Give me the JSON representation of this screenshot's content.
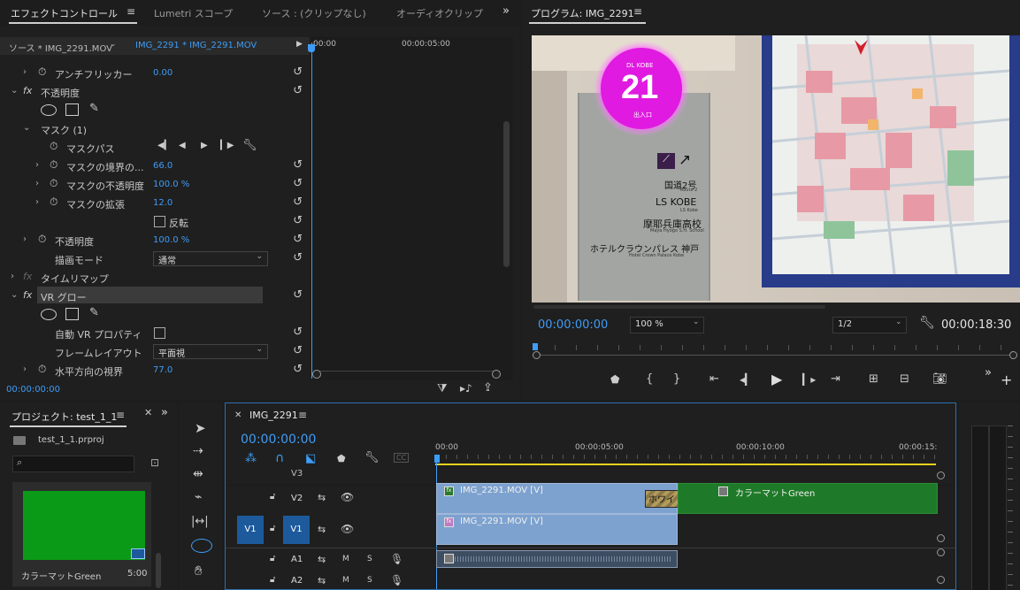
{
  "effects_panel": {
    "tabs": [
      {
        "label": "エフェクトコントロール",
        "active": true
      },
      {
        "label": "Lumetri スコープ"
      },
      {
        "label": "ソース : (クリップなし)"
      },
      {
        "label": "オーディオクリップ"
      }
    ],
    "menu_icon": "hamburger-icon",
    "overflow_icon": "double-chevron-right-icon",
    "source_label": "ソース * IMG_2291.MOV",
    "sequence_label": "IMG_2291 * IMG_2291.MOV",
    "ruler": {
      "start": "00:00",
      "mid": "00:00:05:00"
    },
    "rows": {
      "antiflicker": {
        "label": "アンチフリッカー",
        "value": "0.00"
      },
      "opacity": {
        "label": "不透明度"
      },
      "mask": {
        "label": "マスク (1)"
      },
      "mask_path": {
        "label": "マスクパス"
      },
      "mask_feather": {
        "label": "マスクの境界の...",
        "value": "66.0"
      },
      "mask_opacity": {
        "label": "マスクの不透明度",
        "value": "100.0 %"
      },
      "mask_expansion": {
        "label": "マスクの拡張",
        "value": "12.0"
      },
      "invert": {
        "label": "反転"
      },
      "opacity_value": {
        "label": "不透明度",
        "value": "100.0 %"
      },
      "blend_mode": {
        "label": "描画モード",
        "value": "通常"
      },
      "time_remap": {
        "label": "タイムリマップ"
      },
      "vr_glow": {
        "label": "VR グロー"
      },
      "auto_vr": {
        "label": "自動 VR プロパティ"
      },
      "frame_layout": {
        "label": "フレームレイアウト",
        "value": "平面視"
      },
      "horizontal_fov": {
        "label": "水平方向の視界",
        "value": "77.0"
      }
    },
    "timecode": "00:00:00:00"
  },
  "program_monitor": {
    "title": "プログラム: IMG_2291",
    "timecode": "00:00:00:00",
    "zoom": "100 %",
    "resolution": "1/2",
    "duration": "00:00:18:30",
    "sign": {
      "brand": "DL KOBE",
      "number": "21",
      "exit_label": "出入口",
      "dest1": "国道2号",
      "dest1_en": "Route 2",
      "dest2": "LS KOBE",
      "dest2_en": "LS Kobe",
      "dest3": "摩耶兵庫高校",
      "dest3_en": "Maya Hyogo S.H. School",
      "dest4": "ホテルクラウンパレス 神戸",
      "dest4_en": "Hotel Crown Palace Kobe"
    }
  },
  "project_panel": {
    "title": "プロジェクト: test_1_1",
    "file": "test_1_1.prproj",
    "item_name": "カラーマットGreen",
    "item_duration": "5:00",
    "thumb_color": "#0a9a17"
  },
  "timeline": {
    "title": "IMG_2291",
    "timecode": "00:00:00:00",
    "ruler": [
      "00:00",
      "00:00:05:00",
      "00:00:10:00",
      "00:00:15:"
    ],
    "tracks": [
      {
        "name": "V3"
      },
      {
        "name": "V2"
      },
      {
        "name": "V1",
        "source": "V1"
      },
      {
        "name": "A1",
        "m": "M",
        "s": "S"
      },
      {
        "name": "A2",
        "m": "M",
        "s": "S"
      }
    ],
    "clips": {
      "v2_clip": "IMG_2291.MOV [V]",
      "transition": "ホワイトアウ",
      "color_matte": "カラーマットGreen",
      "v1_clip": "IMG_2291.MOV [V]"
    },
    "colors": {
      "clip_blue": "#7da2cf",
      "matte_green": "#1e7a28",
      "playhead": "#3e9cf5",
      "workarea": "#e6d21a"
    }
  }
}
